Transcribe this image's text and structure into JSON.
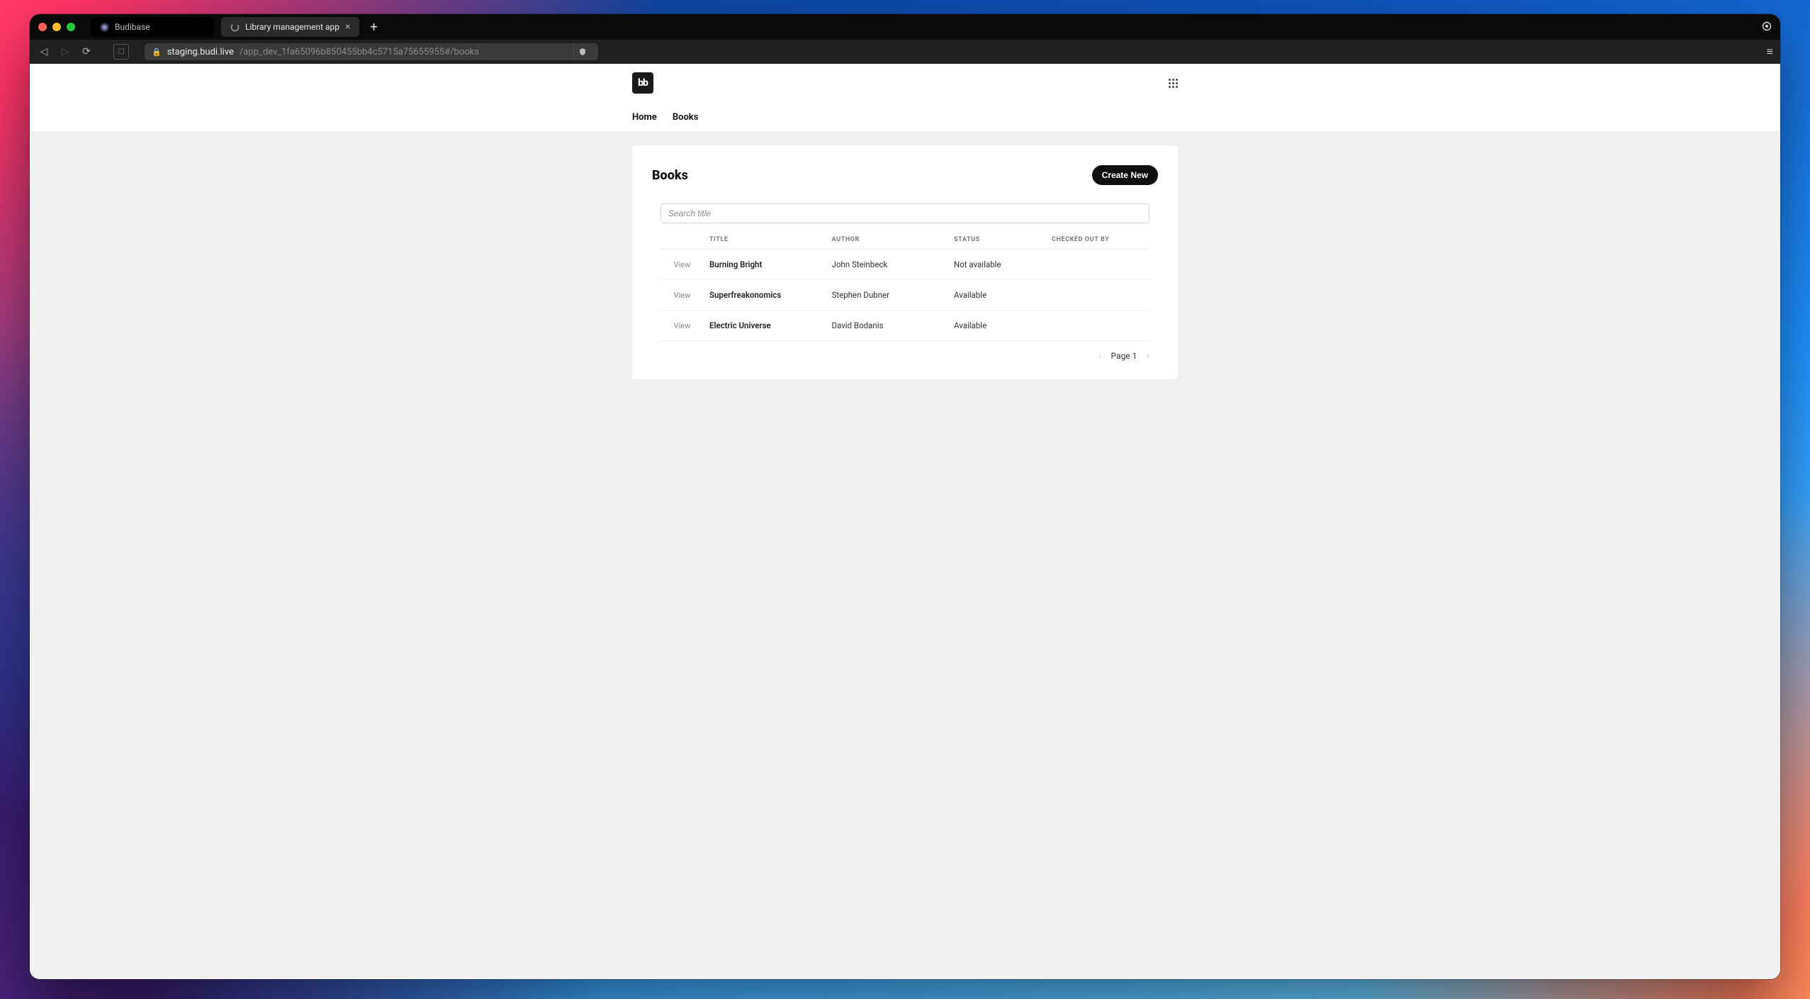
{
  "browser": {
    "tabs": [
      {
        "title": "Budibase",
        "active": false
      },
      {
        "title": "Library management app",
        "active": true
      }
    ],
    "url_host": "staging.budi.live",
    "url_path": "/app_dev_1fa65096b850455bb4c5715a75655955#/books"
  },
  "app": {
    "logo_text": "bb",
    "nav": {
      "home": "Home",
      "books": "Books"
    }
  },
  "page": {
    "title": "Books",
    "create_button": "Create New",
    "search_placeholder": "Search title",
    "columns": {
      "view": "",
      "title": "TITLE",
      "author": "AUTHOR",
      "status": "STATUS",
      "checked_out_by": "CHECKED OUT BY"
    },
    "view_label": "View",
    "rows": [
      {
        "title": "Burning Bright",
        "author": "John Steinbeck",
        "status": "Not available",
        "checked_out_by": ""
      },
      {
        "title": "Superfreakonomics",
        "author": "Stephen Dubner",
        "status": "Available",
        "checked_out_by": ""
      },
      {
        "title": "Electric Universe",
        "author": "David Bodanis",
        "status": "Available",
        "checked_out_by": ""
      }
    ],
    "pagination_label": "Page 1"
  }
}
